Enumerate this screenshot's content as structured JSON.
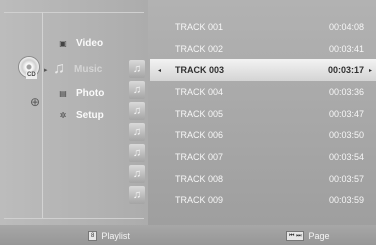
{
  "nav": {
    "disc_label": "CD",
    "items": [
      {
        "label": "Video",
        "icon": "film-icon"
      },
      {
        "label": "Music",
        "icon": "music-note-icon"
      },
      {
        "label": "Photo",
        "icon": "photo-icon"
      },
      {
        "label": "Setup",
        "icon": "gear-icon"
      }
    ]
  },
  "tracks": [
    {
      "name": "TRACK 001",
      "duration": "00:04:08"
    },
    {
      "name": "TRACK 002",
      "duration": "00:03:41"
    },
    {
      "name": "TRACK 003",
      "duration": "00:03:17",
      "selected": true
    },
    {
      "name": "TRACK 004",
      "duration": "00:03:36"
    },
    {
      "name": "TRACK 005",
      "duration": "00:03:47"
    },
    {
      "name": "TRACK 006",
      "duration": "00:03:50"
    },
    {
      "name": "TRACK 007",
      "duration": "00:03:54"
    },
    {
      "name": "TRACK 008",
      "duration": "00:03:57"
    },
    {
      "name": "TRACK 009",
      "duration": "00:03:59"
    }
  ],
  "footer": {
    "playlist_key": "8",
    "playlist_label": "Playlist",
    "page_keys": "⏮ ⏭",
    "page_label": "Page"
  },
  "colors": {
    "background": "#a7a7a7",
    "selected_row": "#e6e6e6",
    "text": "#f7f7f7"
  }
}
